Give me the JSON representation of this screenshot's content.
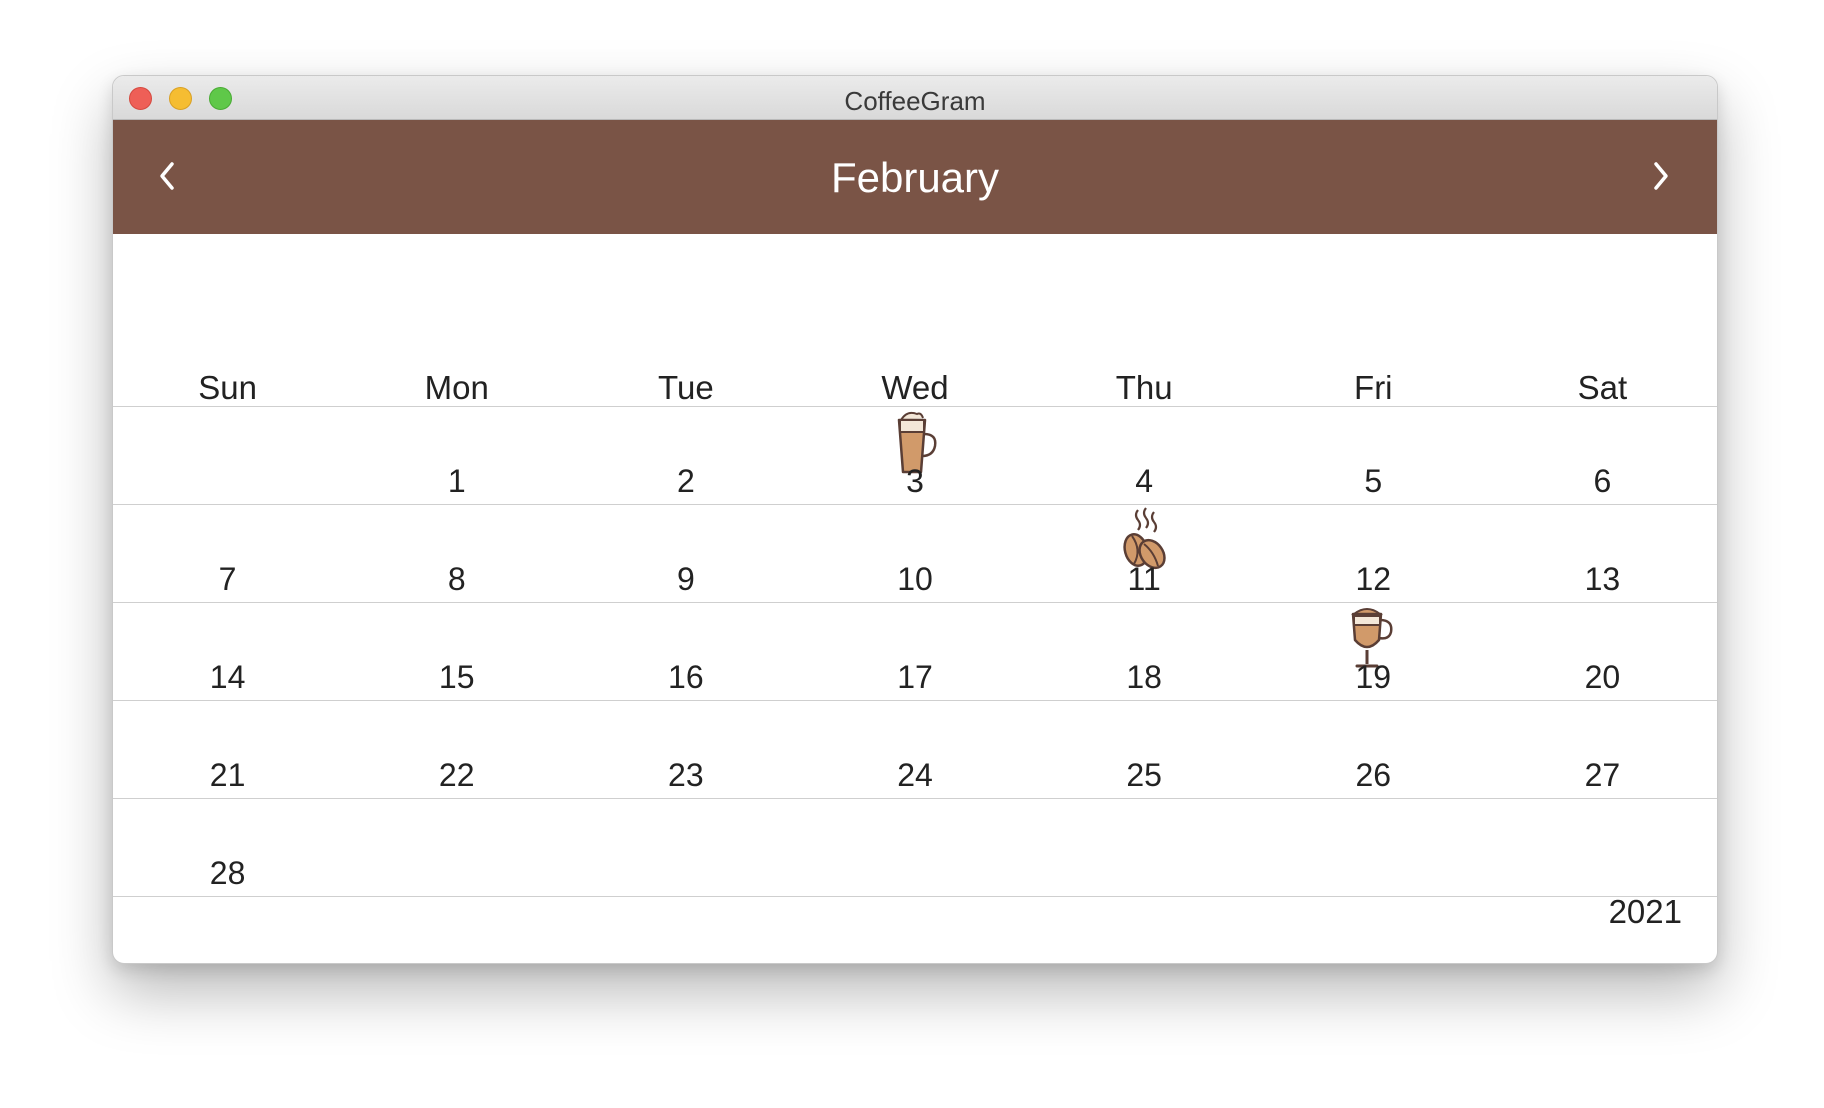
{
  "window": {
    "title": "CoffeeGram"
  },
  "header": {
    "month": "February",
    "prev_icon": "chevron-left-icon",
    "next_icon": "chevron-right-icon"
  },
  "weekdays": [
    "Sun",
    "Mon",
    "Tue",
    "Wed",
    "Thu",
    "Fri",
    "Sat"
  ],
  "weeks": [
    [
      "",
      "1",
      "2",
      "3",
      "4",
      "5",
      "6"
    ],
    [
      "7",
      "8",
      "9",
      "10",
      "11",
      "12",
      "13"
    ],
    [
      "14",
      "15",
      "16",
      "17",
      "18",
      "19",
      "20"
    ],
    [
      "21",
      "22",
      "23",
      "24",
      "25",
      "26",
      "27"
    ],
    [
      "28",
      "",
      "",
      "",
      "",
      "",
      ""
    ]
  ],
  "coffee_entries": [
    {
      "day": "3",
      "icon": "latte-glass-icon"
    },
    {
      "day": "11",
      "icon": "coffee-beans-icon"
    },
    {
      "day": "19",
      "icon": "irish-coffee-icon"
    }
  ],
  "footer": {
    "year": "2021"
  },
  "colors": {
    "header": "#7a5446",
    "icon_fill": "#d19a6a",
    "icon_stroke": "#5a3e35"
  }
}
